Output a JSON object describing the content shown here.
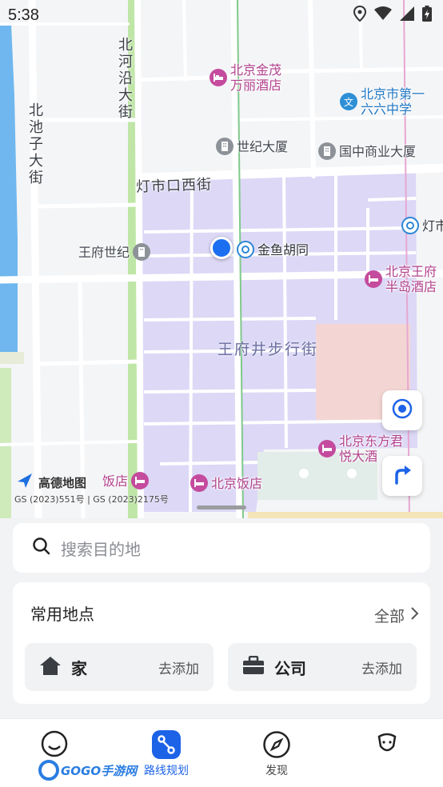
{
  "status_bar": {
    "time": "5:38"
  },
  "map": {
    "roads": {
      "beiheyan": "北河沿大街",
      "beichizi": "北池子大街",
      "dengshikou": "灯市口西街"
    },
    "district": "王府井步行街",
    "pois": [
      {
        "name": "北京金茂\n万丽酒店",
        "type": "hotel"
      },
      {
        "name": "北京市第一\n六六中学",
        "type": "school"
      },
      {
        "name": "世纪大厦",
        "type": "building"
      },
      {
        "name": "国中商业大厦",
        "type": "building"
      },
      {
        "name": "王府世纪",
        "type": "building"
      },
      {
        "name": "金鱼胡同",
        "type": "metro"
      },
      {
        "name": "灯市",
        "type": "metro"
      },
      {
        "name": "北京王府\n半岛酒店",
        "type": "hotel"
      },
      {
        "name": "北京东方君\n悦大酒",
        "type": "hotel"
      },
      {
        "name": "北京饭店",
        "type": "hotel"
      },
      {
        "name": "饭店",
        "type": "hotel"
      }
    ],
    "logo_text": "高德地图",
    "copyright": "GS (2023)551号 | GS (2023)2175号"
  },
  "search": {
    "placeholder": "搜索目的地"
  },
  "common_places": {
    "title": "常用地点",
    "all_label": "全部",
    "home": {
      "label": "家",
      "action": "去添加"
    },
    "company": {
      "label": "公司",
      "action": "去添加"
    }
  },
  "tabs": [
    {
      "label": "",
      "icon": "smile-icon"
    },
    {
      "label": "路线规划",
      "icon": "route-icon"
    },
    {
      "label": "发现",
      "icon": "compass-icon"
    },
    {
      "label": "",
      "icon": "profile-icon"
    }
  ],
  "watermark": "GOGO手游网",
  "colors": {
    "accent": "#1d63e8",
    "hotel": "#c44b9d",
    "school": "#2e8fd6",
    "district": "#dcd7f6"
  }
}
